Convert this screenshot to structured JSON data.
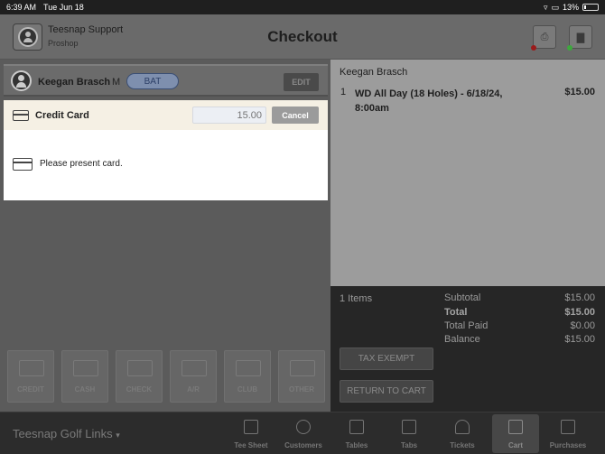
{
  "status_bar": {
    "time": "6:39 AM",
    "date": "Tue Jun 18",
    "battery": "13%",
    "battery_level": 0.13
  },
  "header": {
    "user_name": "Teesnap Support",
    "user_role": "Proshop",
    "title": "Checkout"
  },
  "customer": {
    "name": "Keegan Brasch",
    "gender": "M",
    "tag": "BAT",
    "edit_label": "EDIT"
  },
  "payment": {
    "method": "Credit Card",
    "amount_placeholder": "15.00",
    "cancel_label": "Cancel",
    "message": "Please present card."
  },
  "tenders": [
    {
      "label": "CREDIT",
      "icon": "credit-card-icon"
    },
    {
      "label": "CASH",
      "icon": "cash-icon"
    },
    {
      "label": "CHECK",
      "icon": "check-icon"
    },
    {
      "label": "A/R",
      "icon": "account-icon"
    },
    {
      "label": "CLUB",
      "icon": "ticket-icon"
    },
    {
      "label": "OTHER",
      "icon": "cards-icon"
    }
  ],
  "cart": {
    "customer_name": "Keegan Brasch",
    "items": [
      {
        "qty": "1",
        "description": "WD All Day (18 Holes) - 6/18/24, 8:00am",
        "price": "$15.00"
      }
    ]
  },
  "summary": {
    "items_count": "1 Items",
    "subtotal_label": "Subtotal",
    "subtotal": "$15.00",
    "total_label": "Total",
    "total": "$15.00",
    "total_paid_label": "Total Paid",
    "total_paid": "$0.00",
    "balance_label": "Balance",
    "balance": "$15.00",
    "tax_exempt_label": "TAX EXEMPT",
    "return_label": "RETURN TO CART"
  },
  "tabbar": {
    "location": "Teesnap Golf Links",
    "tabs": [
      {
        "label": "Tee Sheet",
        "icon": "calendar-icon"
      },
      {
        "label": "Customers",
        "icon": "people-icon"
      },
      {
        "label": "Tables",
        "icon": "table-icon"
      },
      {
        "label": "Tabs",
        "icon": "receipt-icon"
      },
      {
        "label": "Tickets",
        "icon": "bell-icon"
      },
      {
        "label": "Cart",
        "icon": "cart-icon",
        "active": true
      },
      {
        "label": "Purchases",
        "icon": "register-icon"
      }
    ]
  },
  "colors": {
    "accent": "#3b4f75",
    "card_header": "#f5f0e4",
    "alert_red": "#9b1b1b",
    "ok_green": "#3da83d"
  }
}
